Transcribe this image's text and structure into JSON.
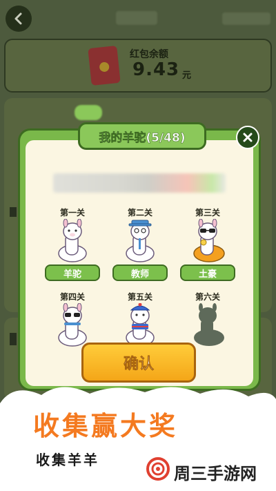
{
  "background_app": {
    "wallet_label": "红包余额",
    "wallet_amount": "9.43",
    "wallet_unit": "元"
  },
  "modal": {
    "title": "我的羊驼(5/48)",
    "close_icon": "close-icon",
    "levels": [
      {
        "level": "第一关",
        "name": "羊驼",
        "unlocked": true
      },
      {
        "level": "第二关",
        "name": "教师",
        "unlocked": true
      },
      {
        "level": "第三关",
        "name": "土豪",
        "unlocked": true
      },
      {
        "level": "第四关",
        "name": "",
        "unlocked": true
      },
      {
        "level": "第五关",
        "name": "",
        "unlocked": true
      },
      {
        "level": "第六关",
        "name": "",
        "unlocked": false
      }
    ],
    "confirm_label": "确认"
  },
  "promo": {
    "title": "收集赢大奖",
    "subtitle": "收集羊羊"
  },
  "watermark": {
    "text": "周三手游网"
  },
  "colors": {
    "accent_green": "#7ab84a",
    "confirm_orange": "#f4a618",
    "promo_orange": "#f47a20"
  }
}
